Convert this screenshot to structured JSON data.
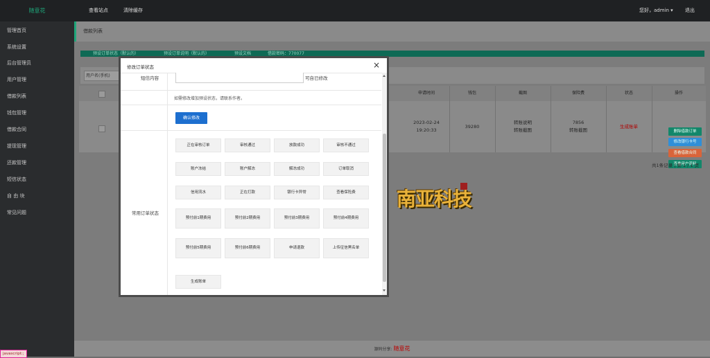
{
  "topbar": {
    "logo": "随意花",
    "nav": [
      "查看站点",
      "清除缓存"
    ],
    "greeting": "您好，admin ▾",
    "logout": "退出"
  },
  "sidebar": {
    "items": [
      "管理首页",
      "系统设置",
      "后台管理员",
      "用户管理",
      "借款列表",
      "钱包管理",
      "借款合同",
      "提现管理",
      "还款管理",
      "短信状态",
      "自 由 块",
      "常见问题"
    ]
  },
  "breadcrumb": "借款列表",
  "status_bar": [
    "预设订单状态（默认的）",
    "预设订单说明（默认的）",
    "预设文档",
    "借款密码：770077"
  ],
  "search": {
    "placeholder": "用户名(手机)"
  },
  "table": {
    "headers": [
      "申请时间",
      "钱包",
      "截图",
      "保险费",
      "状态",
      "操作"
    ],
    "row": {
      "date": "2023-02-24",
      "time": "19:20:33",
      "wallet": "39280",
      "screenshot_1": "转账说明",
      "screenshot_2": "转账截图",
      "insurance_1": "7856",
      "insurance_2": "转账截图",
      "status": "生成账单",
      "actions": [
        "删除借款订单",
        "修改银行卡号",
        "查看借款合同",
        "查看用户资料"
      ]
    }
  },
  "pager": "共1条记录 | 第 1 / 1 页",
  "footer": {
    "prefix": "源码分享:",
    "brand": "随意花"
  },
  "statusbar": "javascript:;",
  "watermark": "南亚科技",
  "modal": {
    "title": "修改订单状态",
    "close": "×",
    "sms_label": "短信内容",
    "sms_suffix": "可自已修改",
    "hint": "如需修改增加预设状态，请联系作者。",
    "confirm": "确认修改",
    "options_label": "常用订单状态",
    "options": [
      "正在审核订单",
      "审核通过",
      "放款成功",
      "审核不通过",
      "账户冻结",
      "账户解冻",
      "解冻成功",
      "订单取消",
      "信用流水",
      "正在打款",
      "银行卡异常",
      "查看保险费",
      "预付前1期费用",
      "预付前2期费用",
      "预付前3期费用",
      "预付前4期费用",
      "预付前5期费用",
      "预付前6期费用",
      "申请退款",
      "上传征信黑名单",
      "生成账单"
    ]
  },
  "colors": {
    "accent": "#1fa67a",
    "confirm": "#1d6fcf",
    "status": "#b00000"
  }
}
